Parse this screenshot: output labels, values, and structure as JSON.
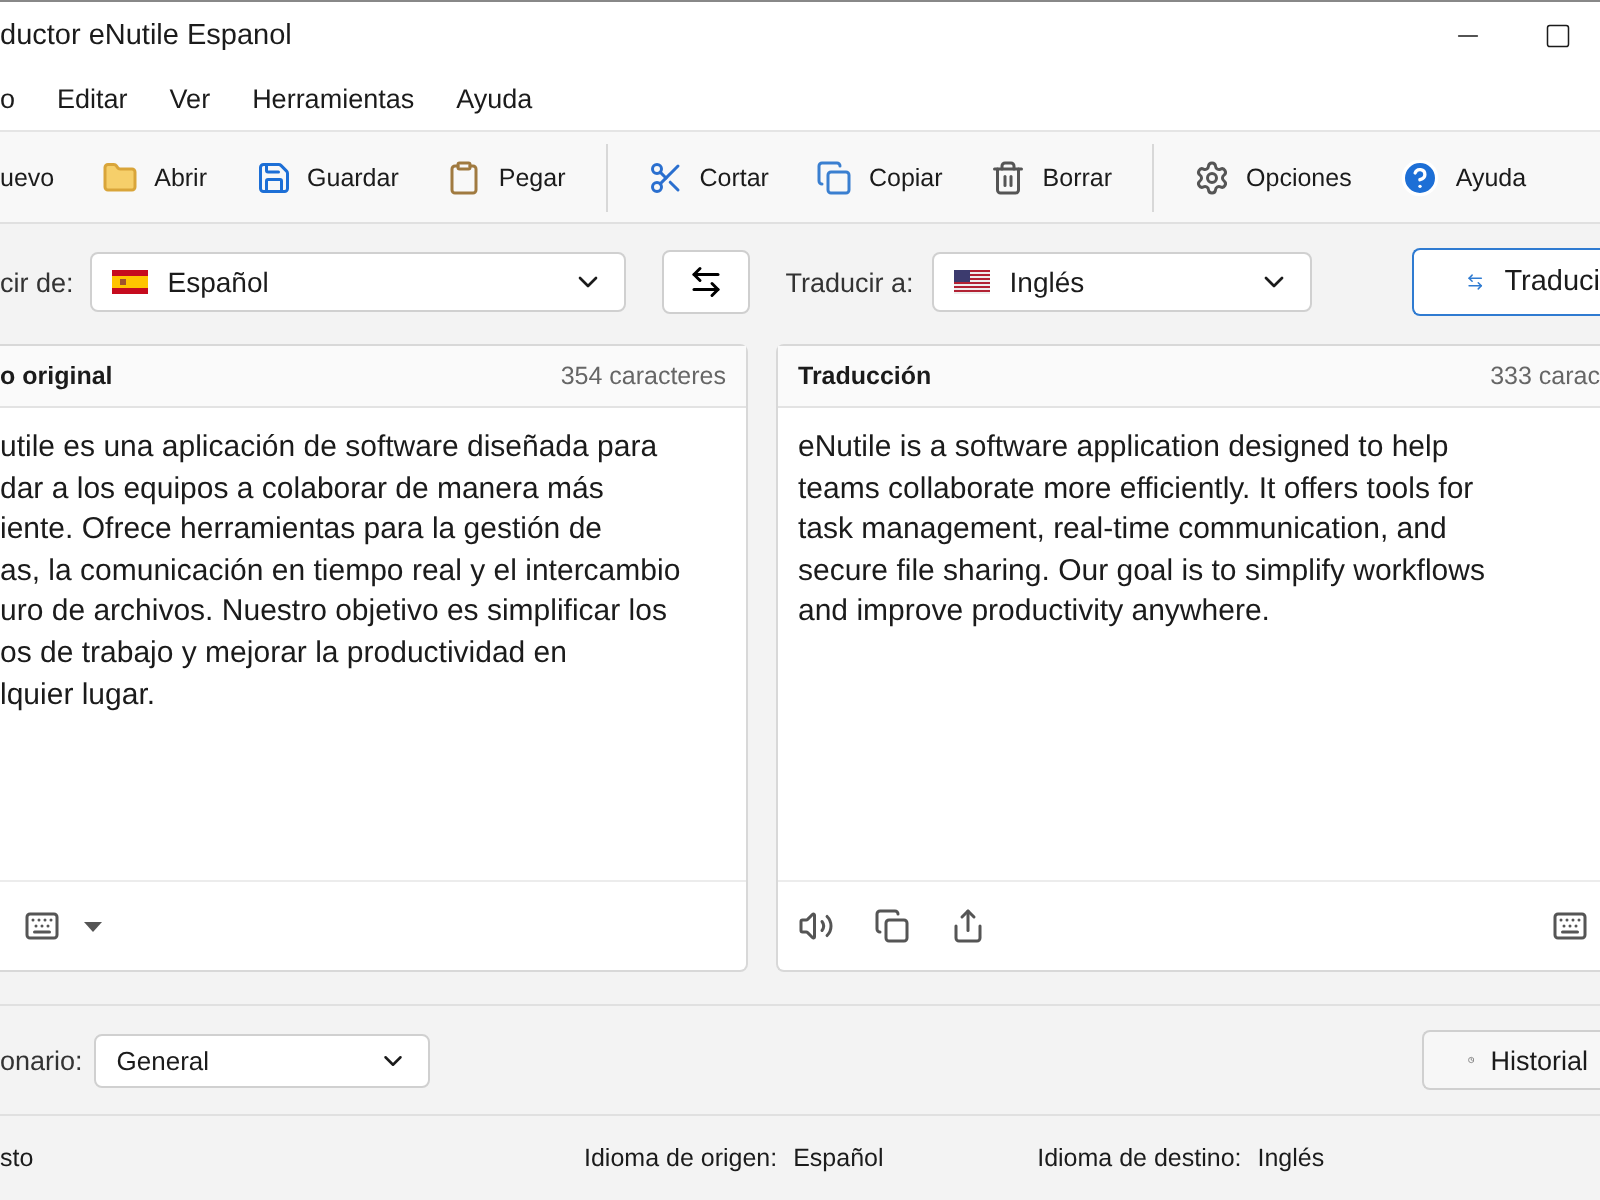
{
  "window": {
    "title": "ductor eNutile Espanol"
  },
  "menu": [
    "o",
    "Editar",
    "Ver",
    "Herramientas",
    "Ayuda"
  ],
  "toolbar": [
    {
      "kind": "new",
      "label": "uevo"
    },
    {
      "kind": "open",
      "label": "Abrir"
    },
    {
      "kind": "save",
      "label": "Guardar"
    },
    {
      "kind": "paste",
      "label": "Pegar"
    },
    {
      "kind": "separator"
    },
    {
      "kind": "cut",
      "label": "Cortar"
    },
    {
      "kind": "copy",
      "label": "Copiar"
    },
    {
      "kind": "delete",
      "label": "Borrar"
    },
    {
      "kind": "separator"
    },
    {
      "kind": "settings",
      "label": "Opciones"
    },
    {
      "kind": "help",
      "label": "Ayuda"
    }
  ],
  "languages": {
    "source_label": "cir de:",
    "source": {
      "kind": "es",
      "value": "Español"
    },
    "target_label": "Traducir a:",
    "target": {
      "kind": "us",
      "value": "Inglés"
    },
    "translate_button": "Traduci"
  },
  "source_panel": {
    "title": "o original",
    "count": "354 caracteres",
    "lines": [
      "utile es una aplicación de software diseñada para",
      "dar a los equipos a colaborar de manera más",
      "iente. Ofrece herramientas para la gestión de",
      "as, la comunicación en tiempo real y el intercambio",
      "uro de archivos. Nuestro objetivo es simplificar los",
      "os de trabajo y mejorar la productividad en",
      "lquier lugar."
    ]
  },
  "target_panel": {
    "title": "Traducción",
    "count": "333 carac",
    "text": "eNutile is a software application designed to help teams collaborate more efficiently. It offers tools for task management, real-time communication, and secure file sharing. Our goal is to simplify workflows and improve productivity anywhere."
  },
  "dictionary": {
    "label": "onario:",
    "value": "General"
  },
  "history_button": "Historial",
  "status_bar": {
    "left": "sto",
    "source_label": "Idioma de origen:",
    "source_value": "Español",
    "target_label": "Idioma de destino:",
    "target_value": "Inglés"
  }
}
